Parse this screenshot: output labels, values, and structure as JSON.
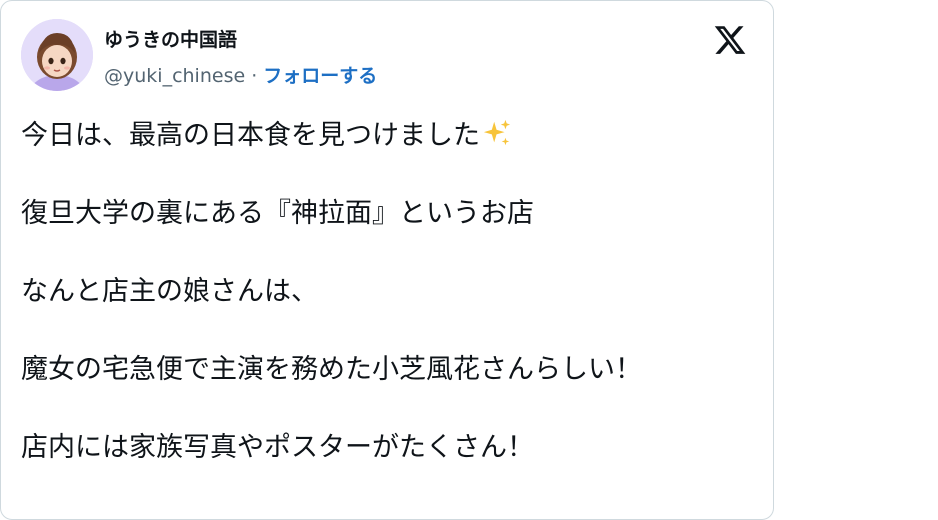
{
  "author": {
    "display_name": "ゆうきの中国語",
    "handle": "@yuki_chinese",
    "separator": " · ",
    "follow_label": "フォローする"
  },
  "post": {
    "paragraphs": [
      {
        "text": "今日は、最高の日本食を見つけました",
        "emoji": "sparkles"
      },
      {
        "text": "復旦大学の裏にある『神拉面』というお店"
      },
      {
        "text": "なんと店主の娘さんは、"
      },
      {
        "text": "魔女の宅急便で主演を務めた小芝風花さんらしい！"
      },
      {
        "text": "店内には家族写真やポスターがたくさん！"
      }
    ]
  },
  "colors": {
    "text": "#0f1419",
    "secondary": "#536471",
    "link": "#1d6fc4",
    "border": "#cfd9de",
    "sparkle": "#f7c43b"
  }
}
